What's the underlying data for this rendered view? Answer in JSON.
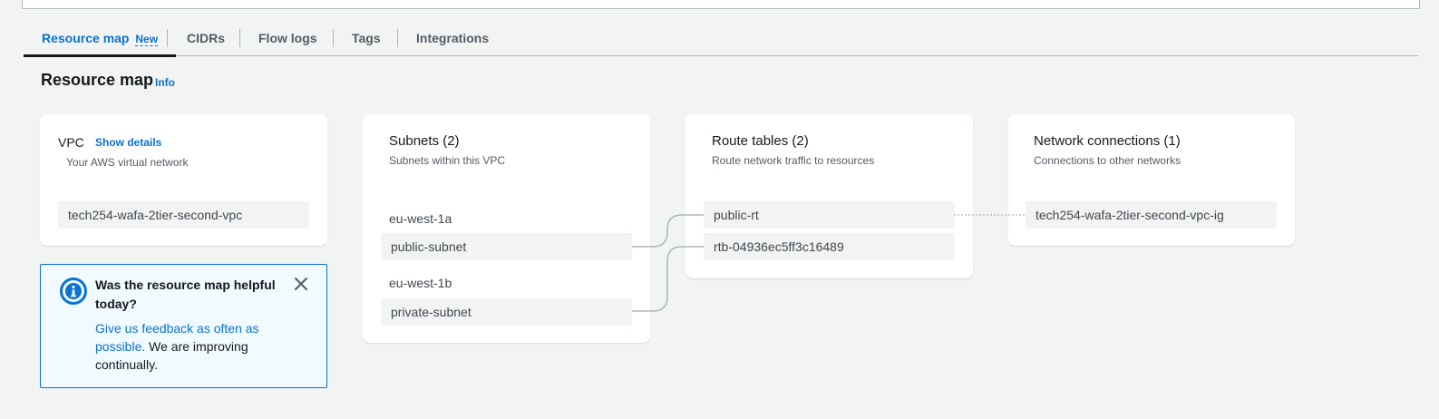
{
  "tabs": [
    {
      "label": "Resource map",
      "badge": "New"
    },
    {
      "label": "CIDRs"
    },
    {
      "label": "Flow logs"
    },
    {
      "label": "Tags"
    },
    {
      "label": "Integrations"
    }
  ],
  "page": {
    "title": "Resource map",
    "info": "Info"
  },
  "vpc": {
    "title": "VPC",
    "show_details": "Show details",
    "subtitle": "Your AWS virtual network",
    "name": "tech254-wafa-2tier-second-vpc"
  },
  "subnets": {
    "title": "Subnets (2)",
    "subtitle": "Subnets within this VPC",
    "groups": [
      {
        "az": "eu-west-1a",
        "subnet": "public-subnet"
      },
      {
        "az": "eu-west-1b",
        "subnet": "private-subnet"
      }
    ]
  },
  "route_tables": {
    "title": "Route tables (2)",
    "subtitle": "Route network traffic to resources",
    "items": [
      "public-rt",
      "rtb-04936ec5ff3c16489"
    ]
  },
  "network_connections": {
    "title": "Network connections (1)",
    "subtitle": "Connections to other networks",
    "items": [
      "tech254-wafa-2tier-second-vpc-ig"
    ]
  },
  "feedback": {
    "title": "Was the resource map helpful today?",
    "link": "Give us feedback as often as possible.",
    "text": " We are improving continually."
  },
  "colors": {
    "accent": "#0972d3",
    "connector": "#aab7b8"
  }
}
